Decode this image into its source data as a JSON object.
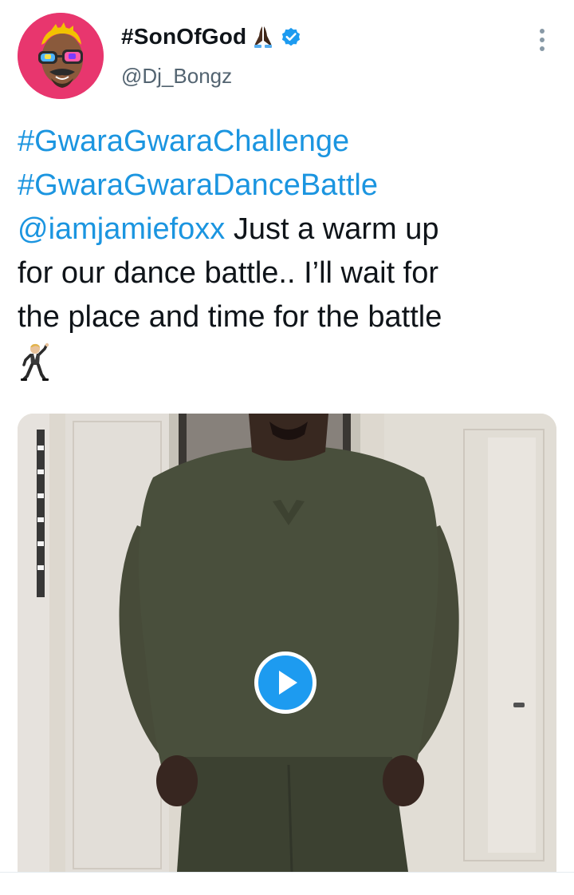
{
  "author": {
    "display_name": "#SonOfGod",
    "handle": "@Dj_Bongz",
    "avatar_icon": "cartoon-avatar-icon",
    "badge_emoji": "folded-hands-icon",
    "verified_icon": "verified-badge-icon"
  },
  "menu": {
    "icon": "more-vertical-icon"
  },
  "tweet": {
    "hashtag_1": "#GwaraGwaraChallenge",
    "hashtag_2": "#GwaraGwaraDanceBattle",
    "mention": "@iamjamiefoxx",
    "text_after_mention": " Just a warm up",
    "line_4": "for our dance battle.. I’ll wait for",
    "line_5": "the place and time for the battle",
    "trailing_emoji": "man-dancing-icon"
  },
  "media": {
    "type": "video",
    "play_icon": "play-icon"
  },
  "colors": {
    "link": "#1b95e0",
    "text": "#0f1419",
    "secondary": "#536471",
    "verified": "#1d9bf0",
    "play_button": "#1d9bf0",
    "avatar_bg": "#e8366e"
  }
}
